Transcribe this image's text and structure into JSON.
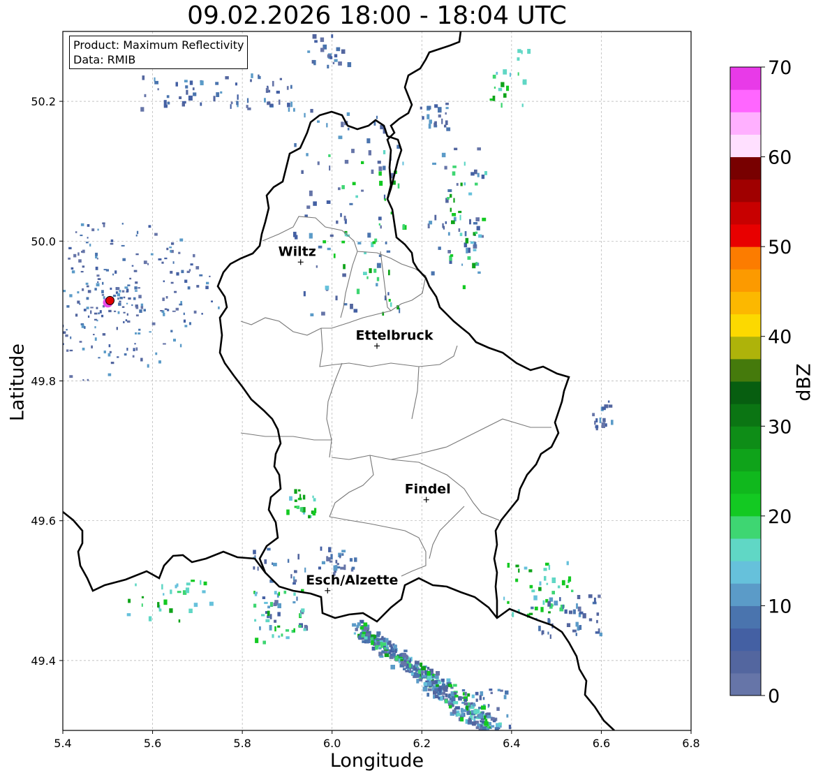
{
  "title": "09.02.2026 18:00 - 18:04 UTC",
  "info": {
    "product": "Product: Maximum Reflectivity",
    "source": "Data: RMIB"
  },
  "axes": {
    "xlabel": "Longitude",
    "ylabel": "Latitude",
    "xlim": [
      5.4,
      6.8
    ],
    "ylim": [
      49.3,
      50.3
    ],
    "xticks": [
      "5.4",
      "5.6",
      "5.8",
      "6.0",
      "6.2",
      "6.4",
      "6.6",
      "6.8"
    ],
    "yticks": [
      "49.4",
      "49.6",
      "49.8",
      "50.0",
      "50.2"
    ],
    "grid": true
  },
  "colorbar": {
    "label": "dBZ",
    "ticks": [
      "0",
      "10",
      "20",
      "30",
      "40",
      "50",
      "60",
      "70"
    ],
    "colors": [
      "#6675a8",
      "#53669f",
      "#4460a3",
      "#4a74ae",
      "#5b9bc8",
      "#66c1db",
      "#60d7c5",
      "#3ed672",
      "#13c922",
      "#10b81d",
      "#0fa31a",
      "#0e8d17",
      "#0b7513",
      "#075e10",
      "#457a0c",
      "#aeb30a",
      "#fcd900",
      "#fcb800",
      "#fc9a00",
      "#fc7c00",
      "#e80000",
      "#c80000",
      "#a00000",
      "#780000",
      "#ffe0ff",
      "#ffb0ff",
      "#ff66ff",
      "#e83ae8"
    ]
  },
  "cities": [
    {
      "name": "Wiltz",
      "lon": 5.93,
      "lat": 49.97,
      "dx": -5,
      "dy": -9
    },
    {
      "name": "Ettelbruck",
      "lon": 6.1,
      "lat": 49.85,
      "dx": 25,
      "dy": -9
    },
    {
      "name": "Findel",
      "lon": 6.21,
      "lat": 49.63,
      "dx": 2,
      "dy": -9
    },
    {
      "name": "Esch/Alzette",
      "lon": 5.99,
      "lat": 49.5,
      "dx": 35,
      "dy": -9
    }
  ],
  "radar_site": {
    "lon": 5.505,
    "lat": 49.915,
    "color": "#e00000"
  },
  "colors": {
    "border": "#000000",
    "district": "#777777",
    "grid": "#b0b0b0"
  }
}
